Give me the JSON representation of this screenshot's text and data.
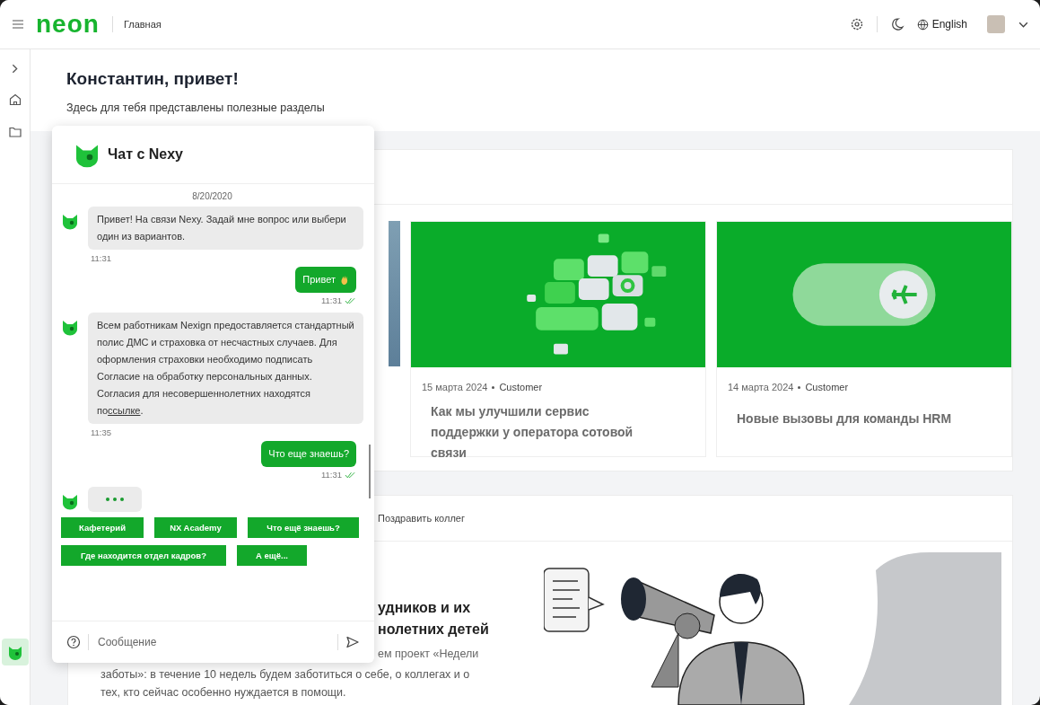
{
  "top_bar": {
    "logo": "neon",
    "breadcrumb": "Главная",
    "language": "English"
  },
  "greeting": {
    "title": "Константин, привет!",
    "subtitle": "Здесь для тебя представлены полезные разделы"
  },
  "news": [
    {
      "date": "15 марта 2024",
      "tag": "Customer",
      "title": "Как мы улучшили сервис поддержки у оператора сотовой связи",
      "kind": "tiles"
    },
    {
      "date": "14 марта 2024",
      "tag": "Customer",
      "title": "Новые вызовы для команды HRM",
      "kind": "toggle"
    }
  ],
  "events": {
    "tab": "Поздравить коллег",
    "heading_lines": [
      "удников и их",
      "нолетних детей"
    ],
    "text_fragment": "ем проект «Недели",
    "text_lines": [
      "заботы»: в течение 10 недель будем заботиться о себе, о коллегах и о",
      "тех, кто сейчас особенно нуждается в помощи."
    ]
  },
  "chat": {
    "title": "Чат с Nexy",
    "date": "8/20/2020",
    "messages": [
      {
        "kind": "bot",
        "text": "Привет! На связи Nexy. Задай мне вопрос или выбери один из вариантов.",
        "time": "11:31"
      },
      {
        "kind": "user",
        "text": "Привет",
        "wave": true,
        "time": "11:31",
        "read": true
      },
      {
        "kind": "bot",
        "text": "Всем работникам Nexign предоставляется стандартный полис ДМС и страховка от несчастных случаев. Для оформления страховки необходимо подписать Согласие на обработку персональных данных. Согласия для несовершеннолетних находятся по",
        "link": "ссылке",
        "after": ".",
        "time": "11:35"
      },
      {
        "kind": "user",
        "text": "Что еще знаешь?",
        "time": "11:31",
        "read": true
      },
      {
        "kind": "typing"
      }
    ],
    "quick_replies": [
      "Кафетерий",
      "NX Academy",
      "Что ещё знаешь?",
      "Где находится отдел кадров?",
      "А ещё..."
    ],
    "input": {
      "placeholder": "Сообщение"
    }
  }
}
